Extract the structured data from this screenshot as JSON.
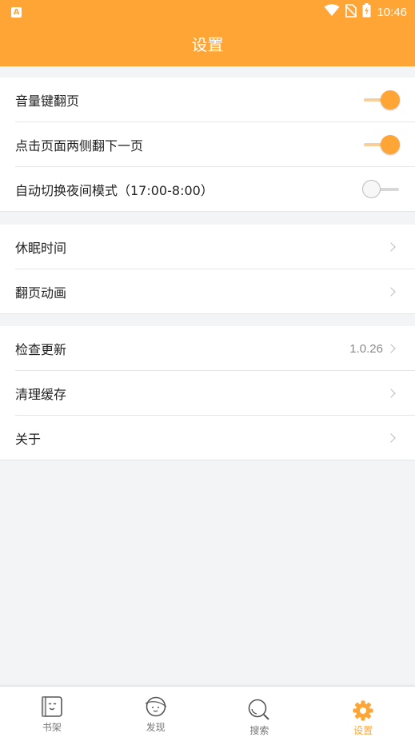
{
  "status_bar": {
    "time": "10:46",
    "app_badge": "A"
  },
  "header": {
    "title": "设置"
  },
  "groups": [
    {
      "items": [
        {
          "label": "音量键翻页",
          "type": "toggle",
          "on": true
        },
        {
          "label": "点击页面两侧翻下一页",
          "type": "toggle",
          "on": true
        },
        {
          "label": "自动切换夜间模式（17:00-8:00）",
          "type": "toggle",
          "on": false
        }
      ]
    },
    {
      "items": [
        {
          "label": "休眠时间",
          "type": "link"
        },
        {
          "label": "翻页动画",
          "type": "link"
        }
      ]
    },
    {
      "items": [
        {
          "label": "检查更新",
          "type": "link",
          "value": "1.0.26"
        },
        {
          "label": "清理缓存",
          "type": "link"
        },
        {
          "label": "关于",
          "type": "link"
        }
      ]
    }
  ],
  "tabs": [
    {
      "label": "书架",
      "icon": "bookshelf-icon",
      "active": false
    },
    {
      "label": "发现",
      "icon": "discover-icon",
      "active": false
    },
    {
      "label": "搜索",
      "icon": "search-icon",
      "active": false
    },
    {
      "label": "设置",
      "icon": "settings-gear-icon",
      "active": true
    }
  ],
  "colors": {
    "accent": "#ffa536",
    "background": "#f3f4f6"
  }
}
